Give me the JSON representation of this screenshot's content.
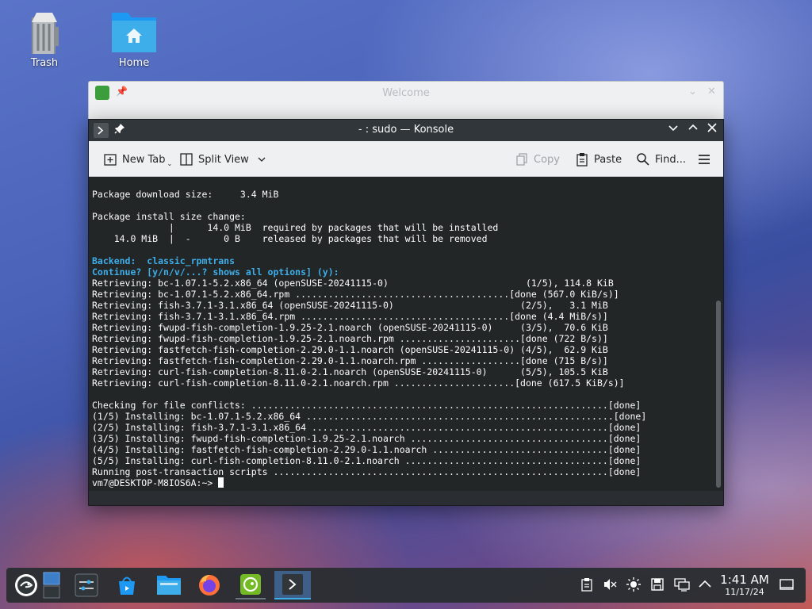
{
  "desktop": {
    "icons": [
      {
        "label": "Trash"
      },
      {
        "label": "Home"
      }
    ]
  },
  "welcome_window": {
    "title": "Welcome"
  },
  "konsole": {
    "title": "- : sudo — Konsole",
    "toolbar": {
      "new_tab": "New Tab",
      "split_view": "Split View",
      "copy": "Copy",
      "paste": "Paste",
      "find": "Find..."
    },
    "terminal_lines": [
      {
        "text": "Package download size:     3.4 MiB",
        "style": ""
      },
      {
        "text": "",
        "style": ""
      },
      {
        "text": "Package install size change:",
        "style": ""
      },
      {
        "text": "              |      14.0 MiB  required by packages that will be installed",
        "style": ""
      },
      {
        "text": "    14.0 MiB  |  -      0 B    released by packages that will be removed",
        "style": ""
      },
      {
        "text": "",
        "style": ""
      },
      {
        "text": "Backend:  classic_rpmtrans",
        "style": "blue"
      },
      {
        "text": "Continue? [y/n/v/...? shows all options] (y):",
        "style": "blue"
      },
      {
        "text": "Retrieving: bc-1.07.1-5.2.x86_64 (openSUSE-20241115-0)                         (1/5), 114.8 KiB",
        "style": ""
      },
      {
        "text": "Retrieving: bc-1.07.1-5.2.x86_64.rpm .......................................[done (567.0 KiB/s)]",
        "style": ""
      },
      {
        "text": "Retrieving: fish-3.7.1-3.1.x86_64 (openSUSE-20241115-0)                       (2/5),   3.1 MiB",
        "style": ""
      },
      {
        "text": "Retrieving: fish-3.7.1-3.1.x86_64.rpm ......................................[done (4.4 MiB/s)]",
        "style": ""
      },
      {
        "text": "Retrieving: fwupd-fish-completion-1.9.25-2.1.noarch (openSUSE-20241115-0)     (3/5),  70.6 KiB",
        "style": ""
      },
      {
        "text": "Retrieving: fwupd-fish-completion-1.9.25-2.1.noarch.rpm ......................[done (722 B/s)]",
        "style": ""
      },
      {
        "text": "Retrieving: fastfetch-fish-completion-2.29.0-1.1.noarch (openSUSE-20241115-0) (4/5),  62.9 KiB",
        "style": ""
      },
      {
        "text": "Retrieving: fastfetch-fish-completion-2.29.0-1.1.noarch.rpm ..................[done (715 B/s)]",
        "style": ""
      },
      {
        "text": "Retrieving: curl-fish-completion-8.11.0-2.1.noarch (openSUSE-20241115-0)      (5/5), 105.5 KiB",
        "style": ""
      },
      {
        "text": "Retrieving: curl-fish-completion-8.11.0-2.1.noarch.rpm ......................[done (617.5 KiB/s)]",
        "style": ""
      },
      {
        "text": "",
        "style": ""
      },
      {
        "text": "Checking for file conflicts: .................................................................[done]",
        "style": ""
      },
      {
        "text": "(1/5) Installing: bc-1.07.1-5.2.x86_64 ........................................................[done]",
        "style": ""
      },
      {
        "text": "(2/5) Installing: fish-3.7.1-3.1.x86_64 ......................................................[done]",
        "style": ""
      },
      {
        "text": "(3/5) Installing: fwupd-fish-completion-1.9.25-2.1.noarch ....................................[done]",
        "style": ""
      },
      {
        "text": "(4/5) Installing: fastfetch-fish-completion-2.29.0-1.1.noarch ................................[done]",
        "style": ""
      },
      {
        "text": "(5/5) Installing: curl-fish-completion-8.11.0-2.1.noarch .....................................[done]",
        "style": ""
      },
      {
        "text": "Running post-transaction scripts .............................................................[done]",
        "style": ""
      }
    ],
    "prompt": "vm7@DESKTOP-M8IOS6A:~>"
  },
  "taskbar": {
    "apps": [
      {
        "icon": "opensuse-start-icon"
      },
      {
        "icon": "pager-icon"
      },
      {
        "icon": "settings-icon"
      },
      {
        "icon": "discover-icon"
      },
      {
        "icon": "dolphin-icon"
      },
      {
        "icon": "firefox-icon"
      },
      {
        "icon": "welcome-app-icon"
      },
      {
        "icon": "konsole-icon"
      }
    ],
    "clock": {
      "time": "1:41 AM",
      "date": "11/17/24"
    },
    "colors": {
      "accent": "#3daee9",
      "panel": "#2a2e32"
    }
  }
}
